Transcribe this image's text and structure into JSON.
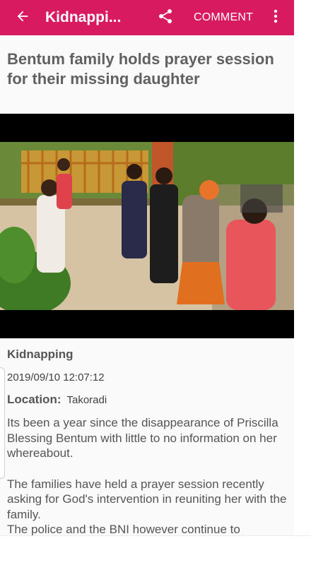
{
  "appbar": {
    "title": "Kidnappi...",
    "comment_label": "COMMENT",
    "back_icon": "arrow-left-icon",
    "share_icon": "share-icon",
    "more_icon": "more-vert-icon",
    "color": "#d81b60"
  },
  "article": {
    "headline": "Bentum family holds prayer session for their missing daughter",
    "category": "Kidnapping",
    "date": "2019/09/10 12:07:12",
    "location_label": "Location:",
    "location_value": "Takoradi",
    "paragraphs": [
      "Its been a year since the disappearance of Priscilla Blessing Bentum with little to no information on her whereabout.",
      "The families have held a prayer session recently asking for God's intervention in reuniting her with the family.",
      "The police and the BNI however continue to"
    ]
  },
  "colors": {
    "text_dark": "#616161",
    "text_body": "#555555"
  }
}
